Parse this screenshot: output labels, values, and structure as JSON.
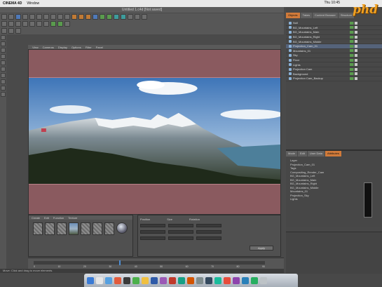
{
  "mac_menubar": {
    "app_name": "CINEMA 4D",
    "items": [
      "Window"
    ],
    "clock": "Thu 10:45"
  },
  "window": {
    "title": "Untitled 1.c4d [Not saved]"
  },
  "viewport": {
    "menu": [
      "View",
      "Cameras",
      "Display",
      "Options",
      "Filter",
      "Panel"
    ]
  },
  "object_manager": {
    "tabs": [
      "Objects",
      "Takes",
      "Content Browser",
      "Structure"
    ],
    "items": [
      {
        "label": "Null"
      },
      {
        "label": "BG_Mountains_Left"
      },
      {
        "label": "BG_Mountains_Main"
      },
      {
        "label": "BG_Mountains_Right"
      },
      {
        "label": "BG_Mountains_Middle"
      },
      {
        "label": "Projection_Cam_01"
      },
      {
        "label": "Mountains_01"
      },
      {
        "label": "Sky"
      },
      {
        "label": "Floor"
      },
      {
        "label": "Lights"
      },
      {
        "label": "Projection Cam"
      },
      {
        "label": "Background"
      },
      {
        "label": "Projection Cam_Backup"
      }
    ],
    "selected_index": 5
  },
  "attribute_manager": {
    "tabs": [
      "Mode",
      "Edit",
      "User Data"
    ],
    "active_tab": "Attributes",
    "rows": [
      "Layer",
      "Projection_Cam_01",
      "Tags",
      "Compositing_Render_Cam",
      "BG_Mountains_Left",
      "BG_Mountains_Main",
      "BG_Mountains_Right",
      "BG_Mountains_Middle",
      "Mountains_01",
      "Projection_Sky",
      "Lights"
    ]
  },
  "material_manager": {
    "menu": [
      "Create",
      "Edit",
      "Function",
      "Texture"
    ]
  },
  "coordinates": {
    "headers": [
      "Position",
      "Size",
      "Rotation"
    ],
    "apply_label": "Apply"
  },
  "timeline": {
    "ticks": [
      "0",
      "10",
      "20",
      "30",
      "40",
      "50",
      "60",
      "70",
      "80",
      "90"
    ]
  },
  "status": {
    "text": "Move: Click and drag to move elements."
  },
  "watermark": {
    "text": "phd"
  },
  "colors": {
    "accent": "#d07a3a",
    "safe_frame": "#8a5a5f",
    "selection": "#55637a"
  }
}
